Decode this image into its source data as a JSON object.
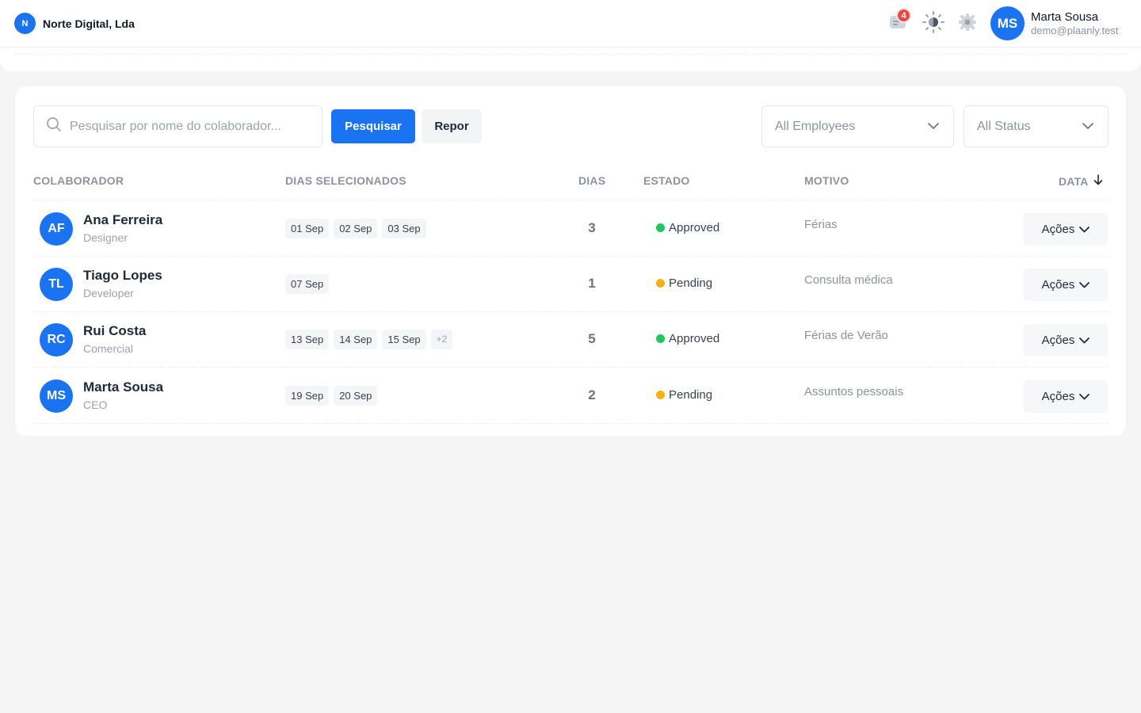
{
  "header": {
    "org_initial": "N",
    "org_name": "Norte Digital, Lda",
    "notification_count": "4",
    "user_initials": "MS",
    "user_name": "Marta Sousa",
    "user_email": "demo@plaanly.test",
    "icons": [
      "notification-icon",
      "theme-toggle-icon",
      "settings-icon"
    ]
  },
  "filters": {
    "search_placeholder": "Pesquisar por nome do colaborador...",
    "search_value": "",
    "search_button": "Pesquisar",
    "reset_button": "Repor",
    "employee_select": "All Employees",
    "status_select": "All Status"
  },
  "table": {
    "columns": {
      "employee": "COLABORADOR",
      "selected_days": "DIAS SELECIONADOS",
      "days": "DIAS",
      "status": "ESTADO",
      "reason": "MOTIVO",
      "date": "DATA"
    },
    "rows": [
      {
        "initials": "AF",
        "name": "Ana Ferreira",
        "role": "Designer",
        "chips": [
          "01 Sep",
          "02 Sep",
          "03 Sep"
        ],
        "more": "",
        "count": "3",
        "status": "Approved",
        "status_color": "#22c55e",
        "reason": "Férias",
        "action": "Ações"
      },
      {
        "initials": "TL",
        "name": "Tiago Lopes",
        "role": "Developer",
        "chips": [
          "07 Sep"
        ],
        "more": "",
        "count": "1",
        "status": "Pending",
        "status_color": "#f5b016",
        "reason": "Consulta médica",
        "action": "Ações"
      },
      {
        "initials": "RC",
        "name": "Rui Costa",
        "role": "Comercial",
        "chips": [
          "13 Sep",
          "14 Sep",
          "15 Sep"
        ],
        "more": "+2",
        "count": "5",
        "status": "Approved",
        "status_color": "#22c55e",
        "reason": "Férias de Verão",
        "action": "Ações"
      },
      {
        "initials": "MS",
        "name": "Marta Sousa",
        "role": "CEO",
        "chips": [
          "19 Sep",
          "20 Sep"
        ],
        "more": "",
        "count": "2",
        "status": "Pending",
        "status_color": "#f5b016",
        "reason": "Assuntos pessoais",
        "action": "Ações"
      }
    ]
  },
  "colors": {
    "accent": "#1a73f0",
    "approved": "#22c55e",
    "pending": "#f5b016"
  }
}
